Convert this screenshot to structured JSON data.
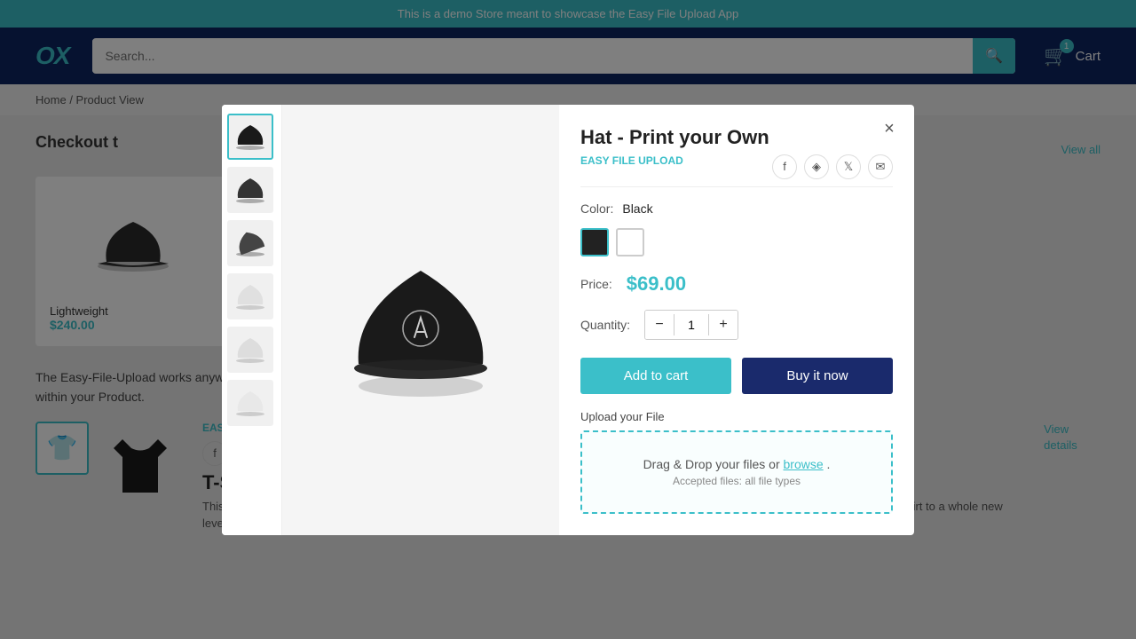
{
  "announcement": {
    "text": "This is a demo Store meant to showcase the Easy File Upload App"
  },
  "header": {
    "logo": "OX",
    "search_placeholder": "Search...",
    "cart_label": "Cart",
    "cart_count": "1"
  },
  "breadcrumb": {
    "home": "Home",
    "separator": "/",
    "current": "Product View"
  },
  "page": {
    "checkout_title": "Checkout t",
    "view_all": "View all",
    "description": "The Easy-File-Upload works anywhere within a Product Form and you can use a simple CSS class or 2.0 Theme to position it anywhere within your Product.",
    "view_details": "View details"
  },
  "background_product": {
    "name": "Lightweight",
    "price": "$240.00"
  },
  "bottom_product": {
    "title": "T-Shirt - Print your Own",
    "easy_file_label": "EASY FILE UPLOAD",
    "description": "This t-shirt is a must-have in your wardrobe, combining the timeless fit of a classic tee with an intricate embroidered detail that brings the shirt to a whole new level. It's soft and"
  },
  "modal": {
    "title": "Hat - Print your Own",
    "easy_file_label": "EASY FILE UPLOAD",
    "close_label": "×",
    "color_label": "Color:",
    "color_value": "Black",
    "colors": [
      {
        "id": "black",
        "label": "Black",
        "active": true
      },
      {
        "id": "white",
        "label": "White",
        "active": false
      }
    ],
    "price_label": "Price:",
    "price": "$69.00",
    "quantity_label": "Quantity:",
    "quantity": "1",
    "qty_minus": "−",
    "qty_plus": "+",
    "add_to_cart_label": "Add to cart",
    "buy_now_label": "Buy it now",
    "upload_label": "Upload your File",
    "upload_text": "Drag & Drop your files or",
    "upload_browse": "browse",
    "upload_accepted": "Accepted files: all file types",
    "social": {
      "facebook": "f",
      "pinterest": "p",
      "twitter": "t",
      "email": "✉"
    },
    "thumbnails": [
      {
        "id": "thumb1",
        "active": true
      },
      {
        "id": "thumb2",
        "active": false
      },
      {
        "id": "thumb3",
        "active": false
      },
      {
        "id": "thumb4",
        "active": false
      },
      {
        "id": "thumb5",
        "active": false
      },
      {
        "id": "thumb6",
        "active": false
      }
    ]
  }
}
